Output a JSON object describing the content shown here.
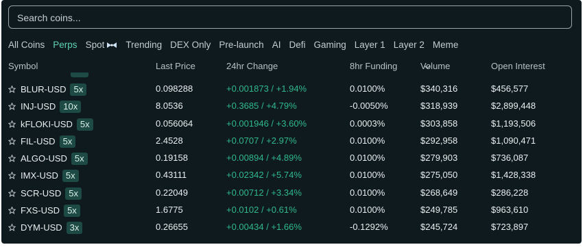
{
  "search": {
    "placeholder": "Search coins...",
    "value": ""
  },
  "tabs": [
    {
      "label": "All Coins",
      "active": false
    },
    {
      "label": "Perps",
      "active": true
    },
    {
      "label": "Spot",
      "active": false,
      "icon": "bow-tie-icon"
    },
    {
      "label": "Trending",
      "active": false
    },
    {
      "label": "DEX Only",
      "active": false
    },
    {
      "label": "Pre-launch",
      "active": false
    },
    {
      "label": "AI",
      "active": false
    },
    {
      "label": "Defi",
      "active": false
    },
    {
      "label": "Gaming",
      "active": false
    },
    {
      "label": "Layer 1",
      "active": false
    },
    {
      "label": "Layer 2",
      "active": false
    },
    {
      "label": "Meme",
      "active": false
    }
  ],
  "columns": {
    "symbol": "Symbol",
    "last_price": "Last Price",
    "change_24h": "24hr Change",
    "funding_8h": "8hr Funding",
    "volume": "Volume",
    "open_interest": "Open Interest",
    "sort_icon": "chevron-down-icon"
  },
  "colors": {
    "background": "#0f1a1f",
    "accent": "#5fd3b5",
    "positive": "#2fb98d",
    "badge_bg": "#1d4a44"
  },
  "rows": [
    {
      "symbol": "BLUR-USD",
      "leverage": "5x",
      "price": "0.098288",
      "change": "+0.001873 / +1.94%",
      "funding": "0.0100%",
      "volume": "$340,316",
      "oi": "$456,577"
    },
    {
      "symbol": "INJ-USD",
      "leverage": "10x",
      "price": "8.0536",
      "change": "+0.3685 / +4.79%",
      "funding": "-0.0050%",
      "volume": "$318,939",
      "oi": "$2,899,448"
    },
    {
      "symbol": "kFLOKI-USD",
      "leverage": "5x",
      "price": "0.056064",
      "change": "+0.001946 / +3.60%",
      "funding": "0.0003%",
      "volume": "$303,858",
      "oi": "$1,193,506"
    },
    {
      "symbol": "FIL-USD",
      "leverage": "5x",
      "price": "2.4528",
      "change": "+0.0707 / +2.97%",
      "funding": "0.0100%",
      "volume": "$292,958",
      "oi": "$1,090,471"
    },
    {
      "symbol": "ALGO-USD",
      "leverage": "5x",
      "price": "0.19158",
      "change": "+0.00894 / +4.89%",
      "funding": "0.0100%",
      "volume": "$279,903",
      "oi": "$736,087"
    },
    {
      "symbol": "IMX-USD",
      "leverage": "5x",
      "price": "0.43111",
      "change": "+0.02342 / +5.74%",
      "funding": "0.0100%",
      "volume": "$275,050",
      "oi": "$1,428,338"
    },
    {
      "symbol": "SCR-USD",
      "leverage": "5x",
      "price": "0.22049",
      "change": "+0.00712 / +3.34%",
      "funding": "0.0100%",
      "volume": "$268,649",
      "oi": "$286,228"
    },
    {
      "symbol": "FXS-USD",
      "leverage": "5x",
      "price": "1.6775",
      "change": "+0.0102 / +0.61%",
      "funding": "0.0100%",
      "volume": "$249,785",
      "oi": "$963,610"
    },
    {
      "symbol": "DYM-USD",
      "leverage": "3x",
      "price": "0.26655",
      "change": "+0.00434 / +1.66%",
      "funding": "-0.1292%",
      "volume": "$245,724",
      "oi": "$723,897"
    }
  ]
}
